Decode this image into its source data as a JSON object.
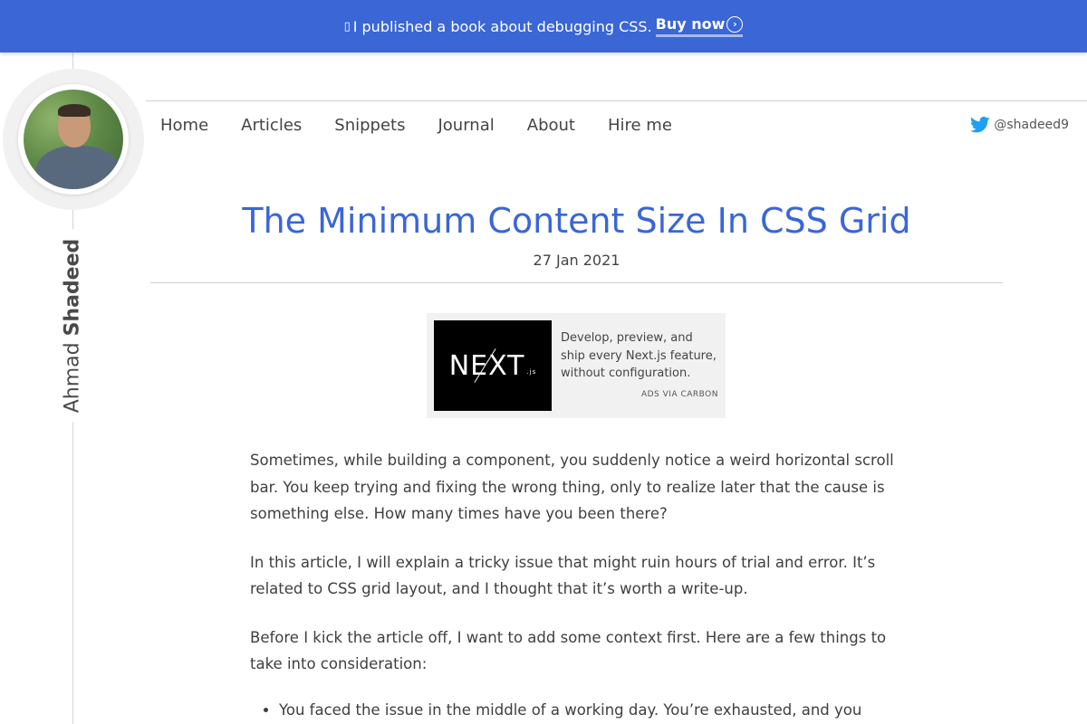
{
  "banner": {
    "icon": "lightning-icon",
    "text": "I published a book about debugging CSS.",
    "cta": "Buy now",
    "background": "#3a66d6"
  },
  "sidebar": {
    "first_name": "Ahmad",
    "last_name": "Shadeed"
  },
  "nav": {
    "items": [
      "Home",
      "Articles",
      "Snippets",
      "Journal",
      "About",
      "Hire me"
    ],
    "twitter_handle": "@shadeed9"
  },
  "article": {
    "title": "The Minimum Content Size In CSS Grid",
    "date": "27 Jan 2021",
    "paragraphs": [
      "Sometimes, while building a component, you suddenly notice a weird horizontal scroll bar. You keep trying and fixing the wrong thing, only to realize later that the cause is something else. How many times have you been there?",
      "In this article, I will explain a tricky issue that might ruin hours of trial and error. It’s related to CSS grid layout, and I thought that it’s worth a write-up.",
      "Before I kick the article off, I want to add some context first. Here are a few things to take into consideration:"
    ],
    "list_items": [
      "You faced the issue in the middle of a working day. You’re exhausted, and you"
    ]
  },
  "ad": {
    "logo_text": "NEXT",
    "logo_suffix": ".js",
    "copy": "Develop, preview, and ship every Next.js feature, without configuration.",
    "via": "ADS VIA CARBON"
  },
  "colors": {
    "accent": "#3a66d6",
    "twitter": "#1da1f2"
  }
}
